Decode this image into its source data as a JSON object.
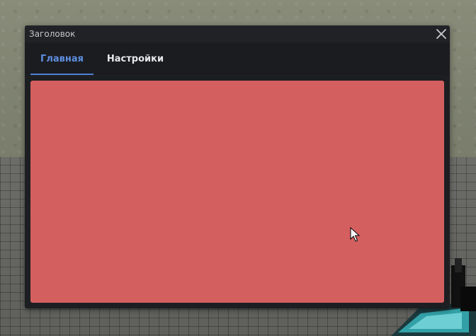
{
  "window": {
    "title": "Заголовок"
  },
  "tabs": [
    {
      "label": "Главная",
      "active": true
    },
    {
      "label": "Настройки",
      "active": false
    }
  ],
  "colors": {
    "window_bg": "#1c1e22",
    "active_tab": "#5f8ee0",
    "content_panel": "#d45f5f"
  },
  "icons": {
    "close": "close-icon",
    "cursor": "mouse-cursor-icon"
  }
}
